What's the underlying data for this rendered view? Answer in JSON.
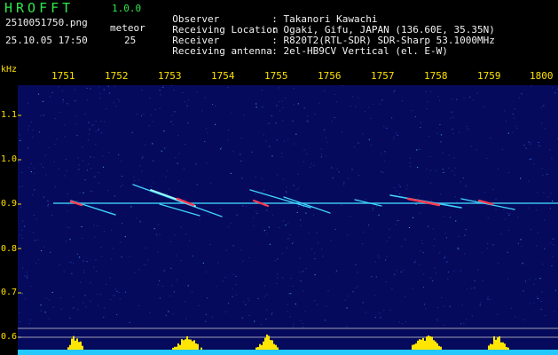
{
  "app": {
    "name": "HROFFT",
    "version": "1.0.0"
  },
  "capture": {
    "filename": "2510051750.png",
    "datetime": "25.10.05 17:50",
    "meteor_label": "meteor",
    "meteor_count": "25"
  },
  "info": [
    {
      "key": "Observer",
      "value": ": Takanori Kawachi"
    },
    {
      "key": "Receiving Location",
      "value": ": Ogaki, Gifu, JAPAN (136.60E, 35.35N)"
    },
    {
      "key": "Receiver",
      "value": ": R820T2(RTL-SDR) SDR-Sharp 53.1000MHz"
    },
    {
      "key": "Receiving antenna",
      "value": ": 2el-HB9CV Vertical (el. E-W)"
    }
  ],
  "axes": {
    "y_unit": "kHz",
    "y_ticks": [
      "1.1",
      "1.0",
      "0.9",
      "0.8",
      "0.7",
      "0.6"
    ],
    "x_ticks": [
      "1751",
      "1752",
      "1753",
      "1754",
      "1755",
      "1756",
      "1757",
      "1758",
      "1759",
      "1800"
    ]
  },
  "colors": {
    "background": "#000000",
    "plot_background": "#060a5c",
    "header_green": "#2ee84a",
    "axis_yellow": "#ffe100",
    "carrier_cyan": "#3fd6ff",
    "meteor_red": "#ff3b4f",
    "level_cyan": "#22c8ff",
    "level_yellow": "#ffe600"
  },
  "chart_data": {
    "type": "heatmap",
    "xlabel": "",
    "ylabel": "kHz",
    "x_tick_labels": [
      "1751",
      "1752",
      "1753",
      "1754",
      "1755",
      "1756",
      "1757",
      "1758",
      "1759",
      "1800"
    ],
    "y_tick_labels": [
      "1.1",
      "1.0",
      "0.9",
      "0.8",
      "0.7",
      "0.6"
    ],
    "ylim": [
      0.6,
      1.1
    ],
    "carrier_frequency_khz": 0.9,
    "grid": false
  }
}
